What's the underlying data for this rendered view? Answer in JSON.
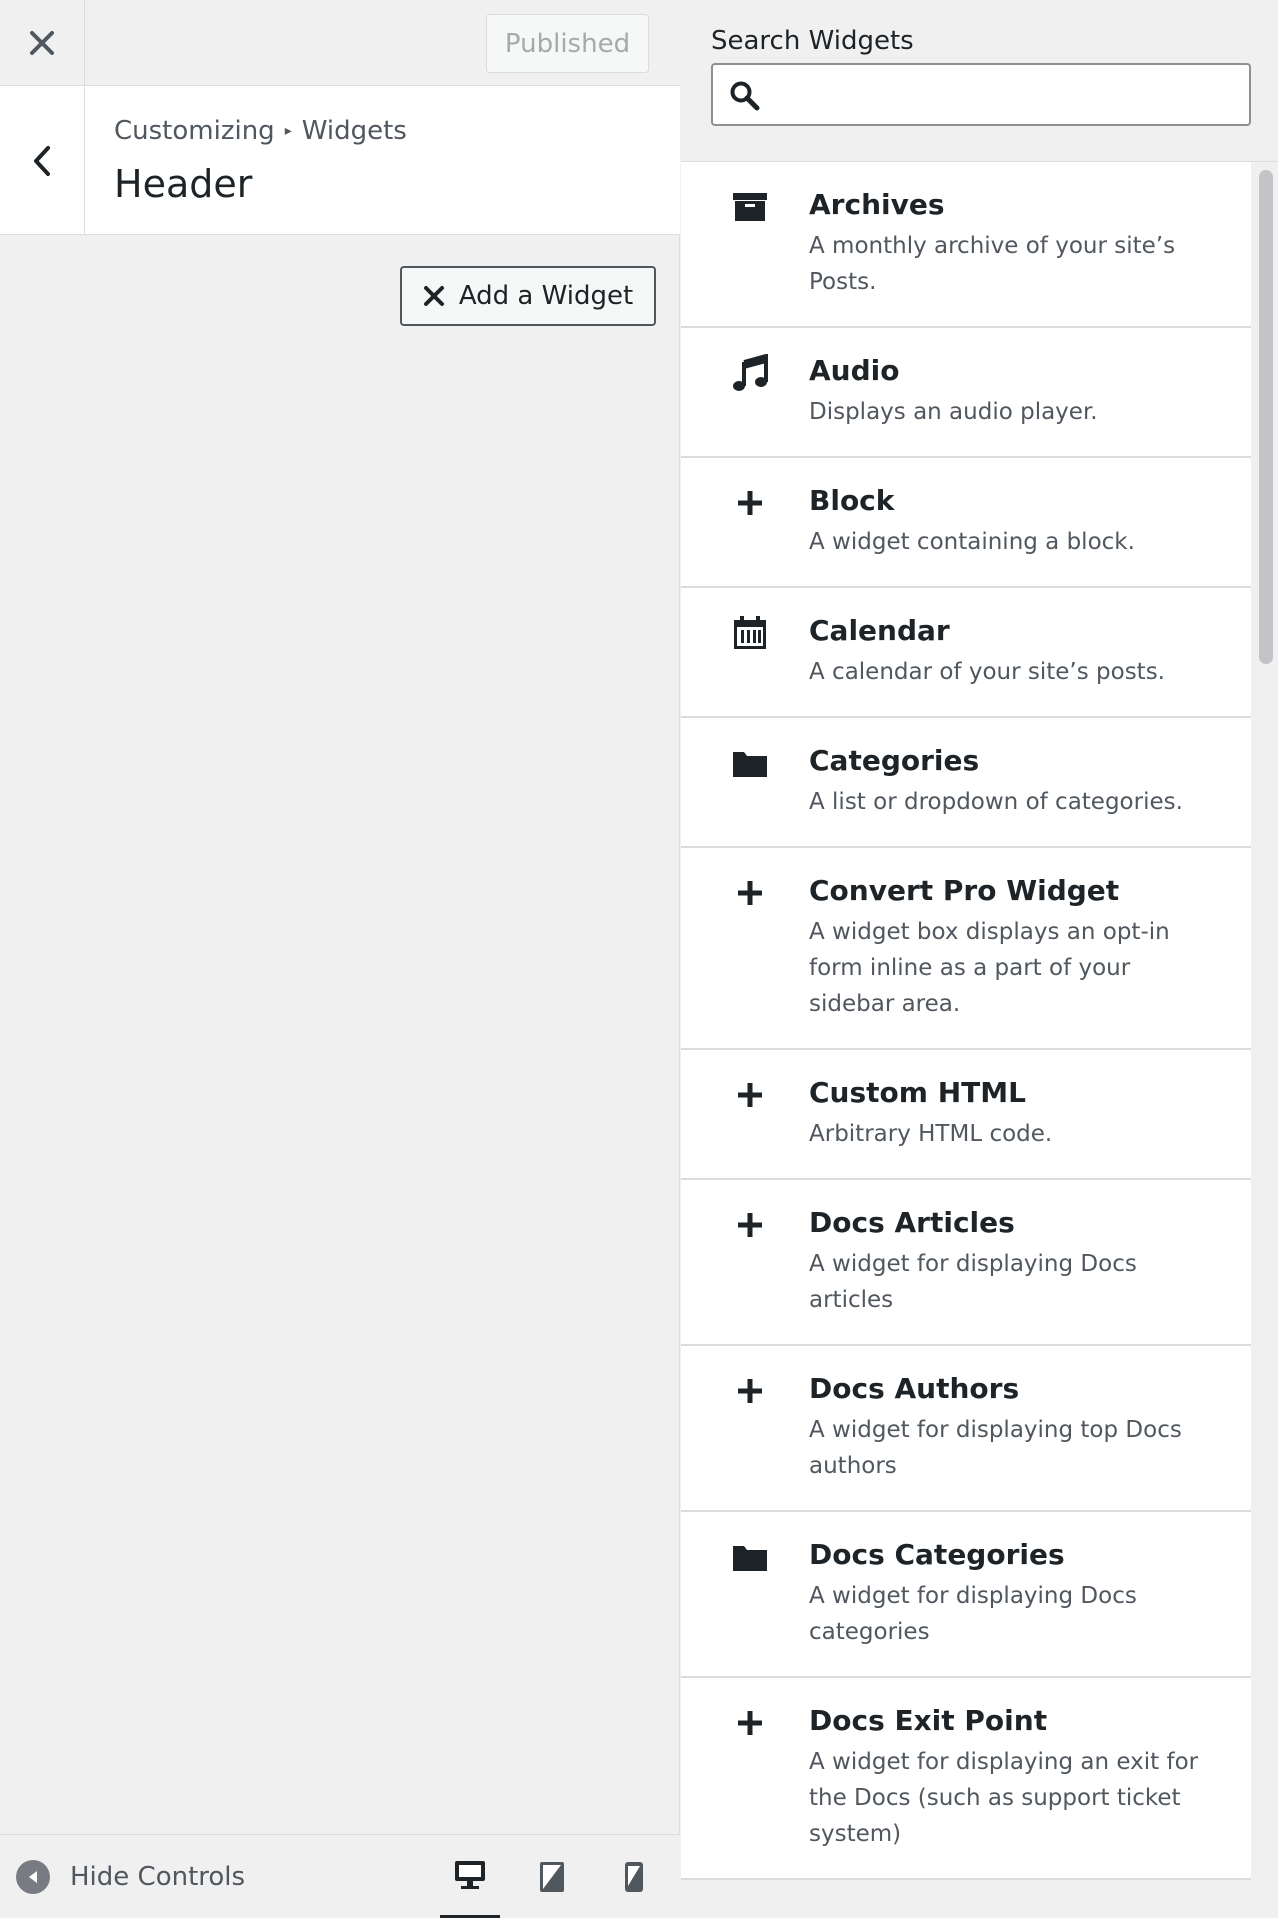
{
  "topbar": {
    "publish_label": "Published"
  },
  "section": {
    "breadcrumb_root": "Customizing",
    "breadcrumb_sep": "▸",
    "breadcrumb_leaf": "Widgets",
    "title": "Header"
  },
  "add_widget": {
    "label": "Add a Widget"
  },
  "footer": {
    "hide_label": "Hide Controls"
  },
  "search": {
    "label": "Search Widgets",
    "value": "",
    "placeholder": ""
  },
  "widgets": [
    {
      "icon": "archive-icon",
      "title": "Archives",
      "desc": "A monthly archive of your site’s Posts."
    },
    {
      "icon": "music-icon",
      "title": "Audio",
      "desc": "Displays an audio player."
    },
    {
      "icon": "plus-icon",
      "title": "Block",
      "desc": "A widget containing a block."
    },
    {
      "icon": "calendar-icon",
      "title": "Calendar",
      "desc": "A calendar of your site’s posts."
    },
    {
      "icon": "folder-icon",
      "title": "Categories",
      "desc": "A list or dropdown of categories."
    },
    {
      "icon": "plus-icon",
      "title": "Convert Pro Widget",
      "desc": "A widget box displays an opt-in form inline as a part of your sidebar area."
    },
    {
      "icon": "plus-icon",
      "title": "Custom HTML",
      "desc": "Arbitrary HTML code."
    },
    {
      "icon": "plus-icon",
      "title": "Docs Articles",
      "desc": "A widget for displaying Docs articles"
    },
    {
      "icon": "plus-icon",
      "title": "Docs Authors",
      "desc": "A widget for displaying top Docs authors"
    },
    {
      "icon": "folder-icon",
      "title": "Docs Categories",
      "desc": "A widget for displaying Docs categories"
    },
    {
      "icon": "plus-icon",
      "title": "Docs Exit Point",
      "desc": "A widget for displaying an exit for the Docs (such as support ticket system)"
    }
  ],
  "colors": {
    "text": "#1d2327",
    "muted": "#50575e",
    "border": "#dcdcde",
    "panel": "#f0f0f1"
  }
}
